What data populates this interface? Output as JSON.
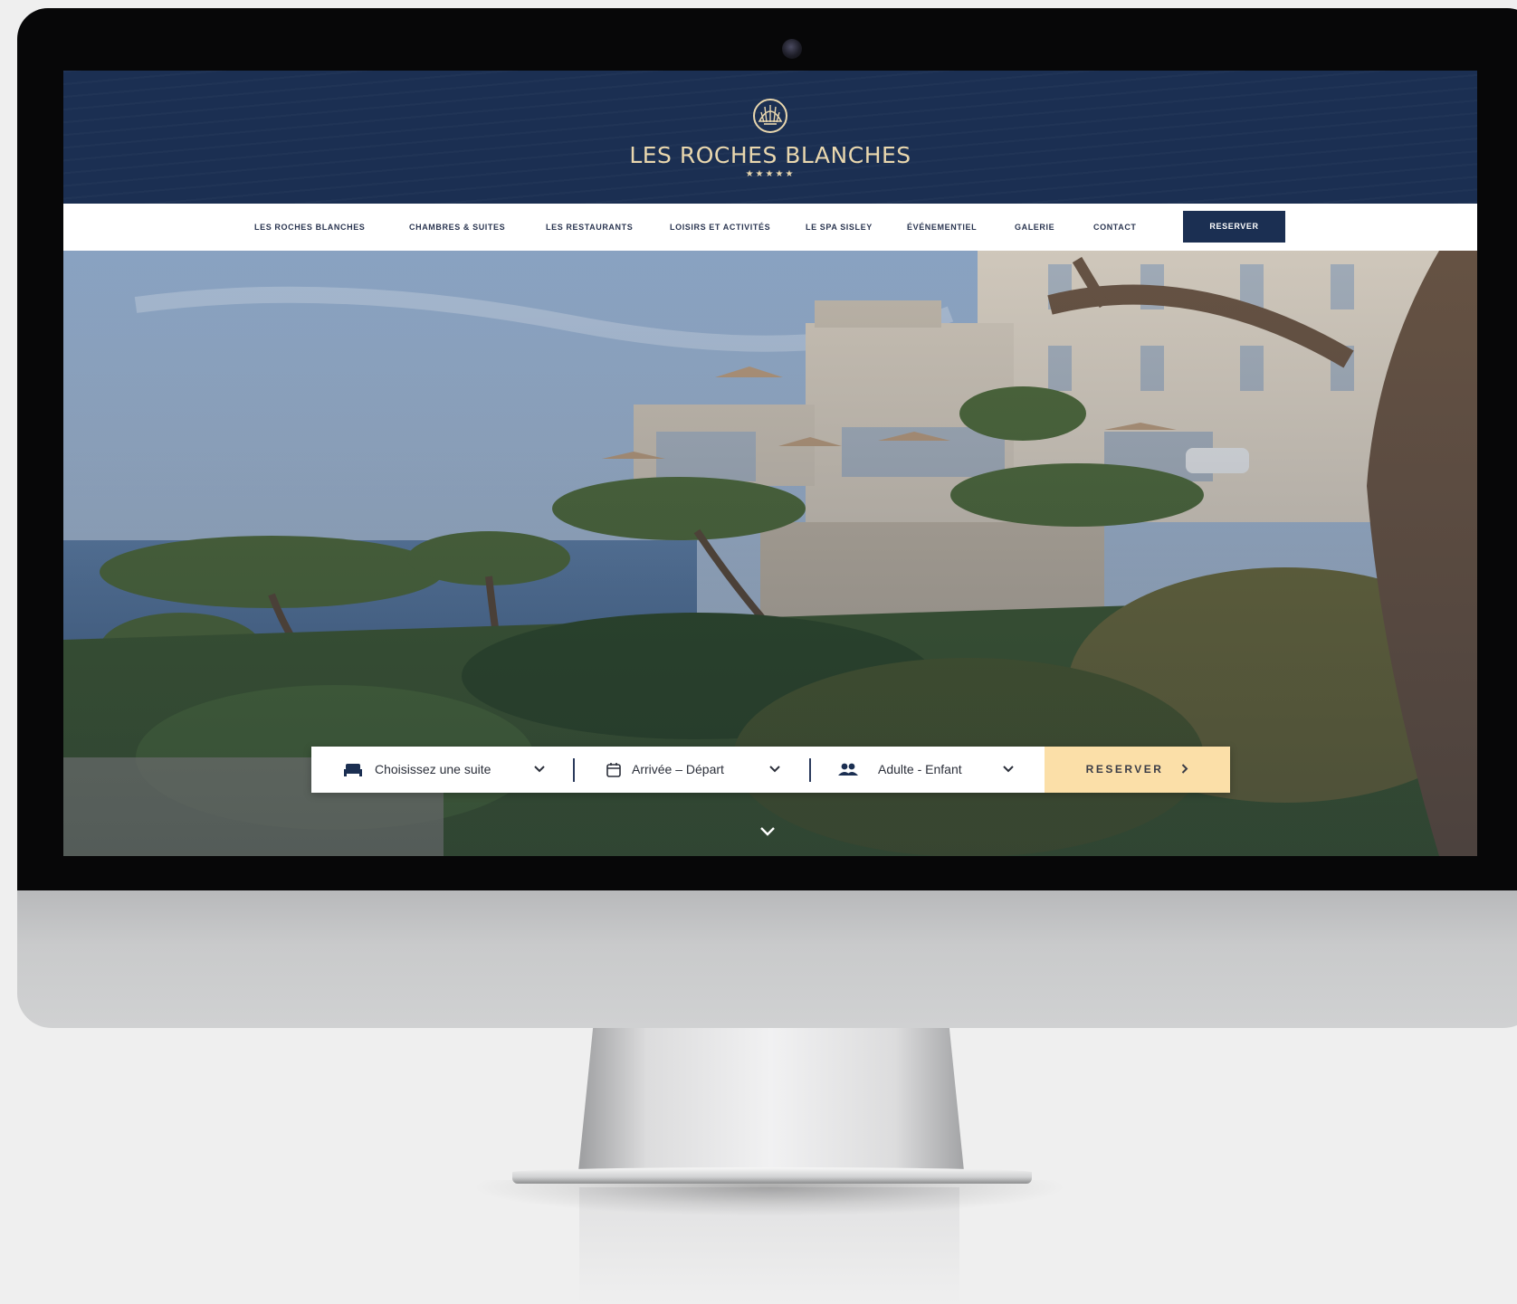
{
  "brand": {
    "name": "LES ROCHES BLANCHES",
    "stars": "★★★★★",
    "emblem": "shell-logo-icon",
    "navy": "#1b2f52",
    "gold": "#e9d7ae"
  },
  "nav": {
    "items": [
      {
        "label": "LES ROCHES BLANCHES"
      },
      {
        "label": "CHAMBRES & SUITES"
      },
      {
        "label": "LES RESTAURANTS"
      },
      {
        "label": "LOISIRS ET ACTIVITÉS"
      },
      {
        "label": "LE SPA SISLEY"
      },
      {
        "label": "ÉVÉNEMENTIEL"
      },
      {
        "label": "GALERIE"
      },
      {
        "label": "CONTACT"
      }
    ],
    "reserve_label": "RESERVER"
  },
  "booking": {
    "suite": {
      "label": "Choisissez une suite",
      "icon": "bed-icon"
    },
    "dates": {
      "label": "Arrivée – Départ",
      "icon": "calendar-icon"
    },
    "guests": {
      "label": "Adulte - Enfant",
      "icon": "people-icon"
    },
    "reserve_label": "RESERVER",
    "reserve_icon": "chevron-right-icon",
    "reserve_color": "#fbdfa8"
  },
  "hero": {
    "scroll_icon": "chevron-down-icon"
  }
}
